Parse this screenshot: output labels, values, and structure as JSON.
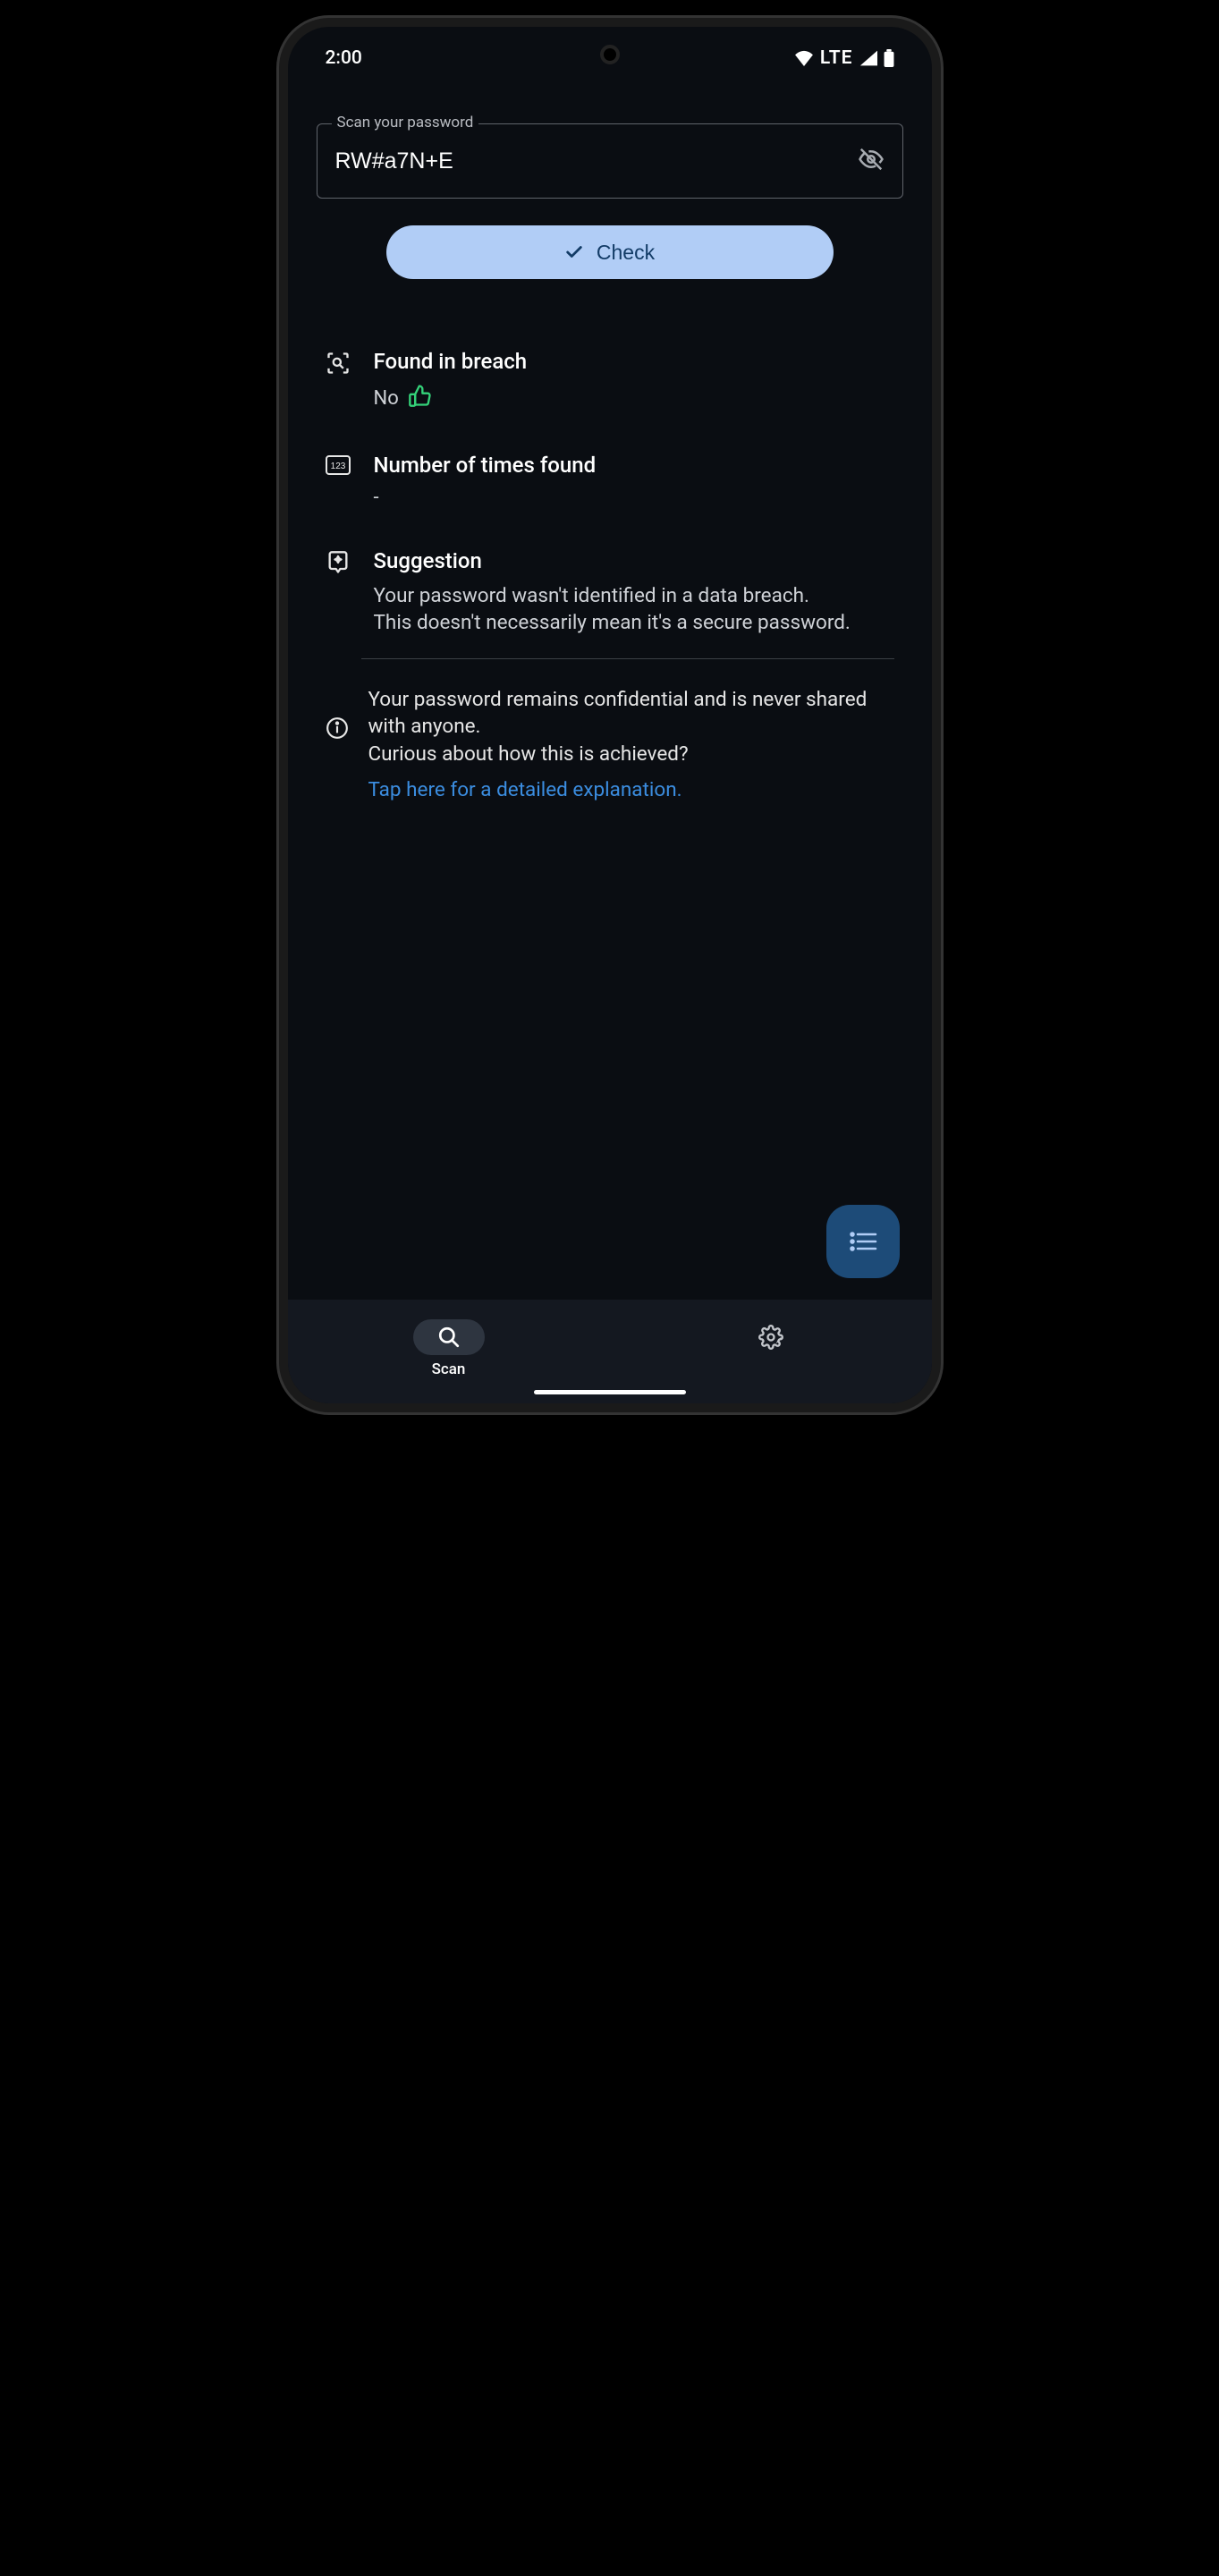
{
  "status_bar": {
    "time": "2:00",
    "network": "LTE"
  },
  "input": {
    "label": "Scan your password",
    "value": "RW#a7N+E"
  },
  "buttons": {
    "check": "Check"
  },
  "results": {
    "breach": {
      "title": "Found in breach",
      "value": "No"
    },
    "count": {
      "title": "Number of times found",
      "value": "-"
    },
    "suggestion": {
      "title": "Suggestion",
      "text": "Your password wasn't identified in a data breach.\nThis doesn't necessarily mean it's a secure password."
    }
  },
  "info": {
    "text": "Your password remains confidential and is never shared with anyone.\nCurious about how this is achieved?",
    "link": "Tap here for a detailed explanation."
  },
  "nav": {
    "scan": "Scan"
  }
}
